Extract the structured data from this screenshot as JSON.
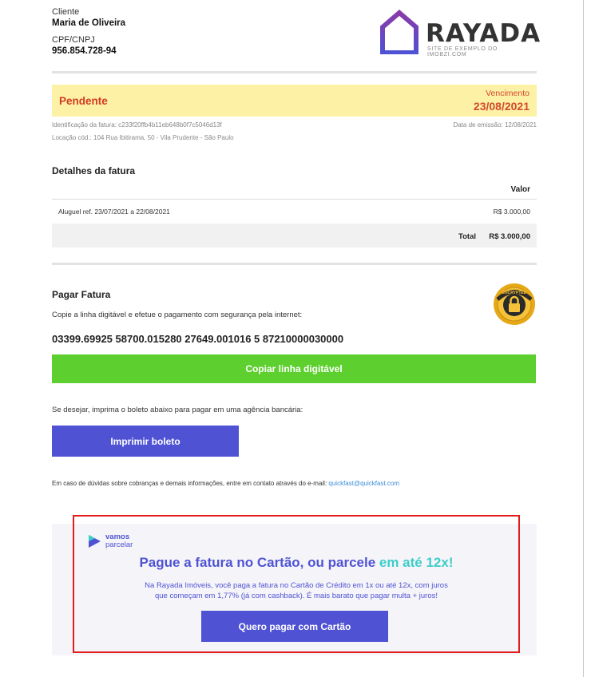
{
  "client": {
    "label": "Cliente",
    "name": "Maria de Oliveira",
    "doc_label": "CPF/CNPJ",
    "doc_value": "956.854.728-94"
  },
  "brand": {
    "name": "RAYADA",
    "tagline": "SITE DE EXEMPLO DO IMOBZI.COM",
    "logo_color": "#7b3fa0"
  },
  "invoice": {
    "status": "Pendente",
    "due_label": "Vencimento",
    "due_date": "23/08/2021",
    "id_text": "Identificação da fatura: c233f20ffb4b11eb648b0f7c5046d13f",
    "emission_text": "Data de emissão: 12/08/2021",
    "location_text": "Locação cód.: 104 Rua Ibitirama, 50 - Vila Prudente - São Paulo"
  },
  "details": {
    "title": "Detalhes da fatura",
    "col_value": "Valor",
    "items": [
      {
        "desc": "Aluguel ref. 23/07/2021 a 22/08/2021",
        "value": "R$ 3.000,00"
      }
    ],
    "total_label": "Total",
    "total_value": "R$ 3.000,00"
  },
  "payment": {
    "title": "Pagar Fatura",
    "instruction": "Copie a linha digitável e efetue o pagamento com segurança pela internet:",
    "barcode": "03399.69925 58700.015280 27649.001016 5 87210000030000",
    "copy_button": "Copiar linha digitável",
    "print_instruction": "Se desejar, imprima o boleto abaixo para pagar em uma agência bancária:",
    "print_button": "Imprimir boleto",
    "contact_text": "Em caso de dúvidas sobre cobranças e demais informações, entre em contato através do e-mail:",
    "contact_email": "quickfast@quickfast.com",
    "seal_text": "ENCRYPTED"
  },
  "promo": {
    "logo_word1": "vamos",
    "logo_word2": "parcelar",
    "title_main": "Pague a fatura no Cartão, ou parcele ",
    "title_highlight": "em até 12x!",
    "desc_line1": "Na Rayada Imóveis, você paga a fatura no Cartão de Crédito em 1x ou até 12x, com juros",
    "desc_line2": "que começam em 1,77% (já com cashback). É mais barato que pagar multa + juros!",
    "button": "Quero pagar com Cartão"
  },
  "colors": {
    "status_bg": "#fdf1a6",
    "status_text": "#d33b1f",
    "copy_button": "#5dcf2e",
    "primary": "#4f52d3",
    "highlight": "#3ecdc8",
    "promo_border": "#e21b1b"
  }
}
